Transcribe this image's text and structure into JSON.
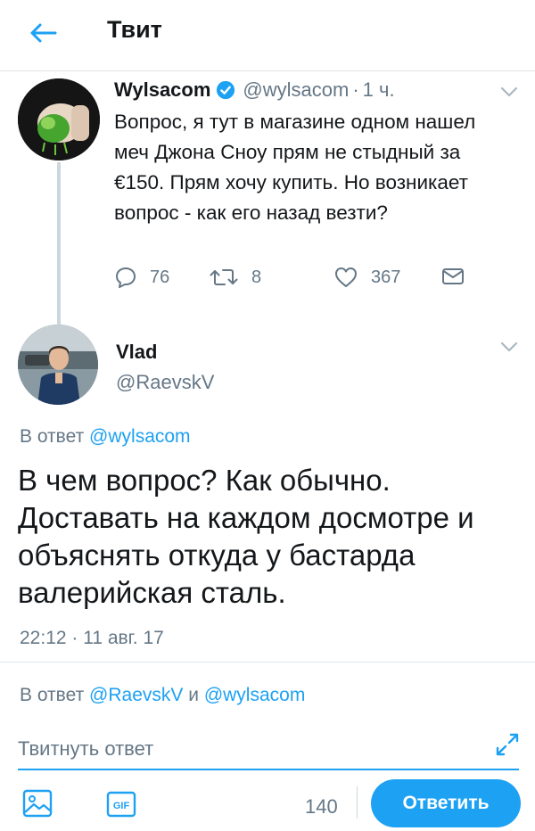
{
  "header": {
    "title": "Твит",
    "back_icon": "arrow-left-icon"
  },
  "colors": {
    "accent": "#1da1f2",
    "text": "#14171a",
    "secondary": "#657786",
    "border": "#e1e8ed"
  },
  "original_tweet": {
    "author_name": "Wylsacom",
    "verified": true,
    "handle": "@wylsacom",
    "separator": "·",
    "time": "1 ч.",
    "text": "Вопрос, я тут в магазине одном нашел меч Джона Сноу прям не стыдный за €150. Прям хочу купить. Но возникает вопрос - как его назад везти?",
    "replies": "76",
    "retweets": "8",
    "likes": "367"
  },
  "reply_tweet": {
    "author_name": "Vlad",
    "handle": "@RaevskV",
    "reply_to_prefix": "В ответ",
    "reply_to_handle": "@wylsacom",
    "text": "В чем вопрос? Как обычно. Доставать на каждом досмотре и объяснять откуда у бастарда валерийская сталь.",
    "timestamp": "22:12 · 11 авг. 17"
  },
  "composer": {
    "reply_to_prefix": "В ответ",
    "reply_to_handle_1": "@RaevskV",
    "conjunction": "и",
    "reply_to_handle_2": "@wylsacom",
    "placeholder": "Твитнуть ответ",
    "gif_label": "GIF",
    "char_count": "140",
    "submit_label": "Ответить"
  }
}
